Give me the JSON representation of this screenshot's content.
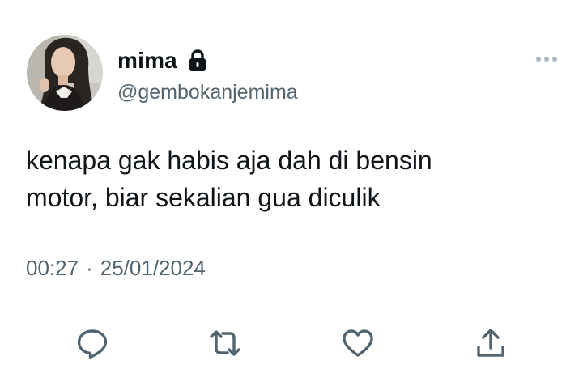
{
  "tweet": {
    "author": {
      "display_name": "mima",
      "handle": "@gembokanjemima",
      "protected_icon": "lock-icon",
      "avatar": "avatar-photo"
    },
    "text_lines": [
      "kenapa gak habis aja dah di bensin",
      "motor, biar sekalian gua diculik"
    ],
    "time": "00:27",
    "separator": "·",
    "date": "25/01/2024",
    "more_icon": "more-horizontal-icon"
  },
  "actions": {
    "reply_icon": "reply-icon",
    "retweet_icon": "retweet-icon",
    "like_icon": "heart-icon",
    "share_icon": "share-icon"
  },
  "colors": {
    "text_primary": "#0f1419",
    "text_secondary": "#536471",
    "divider": "#eff3f4"
  }
}
